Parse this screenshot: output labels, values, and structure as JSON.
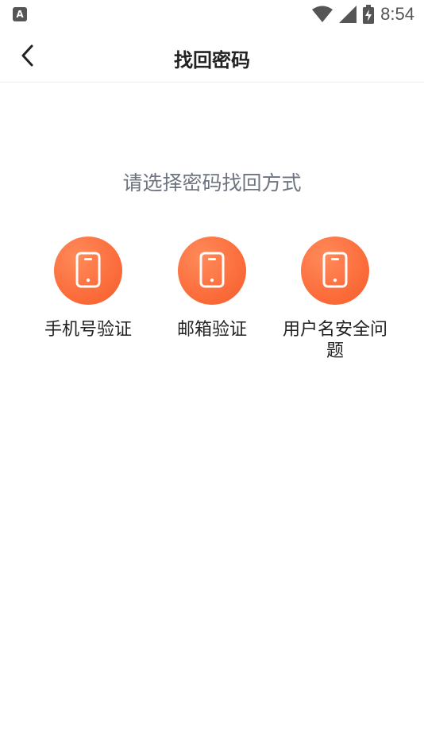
{
  "status_bar": {
    "left_icon_letter": "A",
    "time": "8:54",
    "icons": [
      "wifi-icon",
      "signal-icon",
      "battery-charging-icon"
    ]
  },
  "header": {
    "title": "找回密码",
    "back_icon": "chevron-left-icon"
  },
  "prompt": "请选择密码找回方式",
  "options": [
    {
      "label": "手机号验证",
      "icon": "phone-icon"
    },
    {
      "label": "邮箱验证",
      "icon": "phone-icon"
    },
    {
      "label": "用户名安全问题",
      "icon": "phone-icon"
    }
  ],
  "colors": {
    "accent": "#fc6d3c",
    "prompt_text": "#6e7480",
    "title_text": "#222222"
  }
}
